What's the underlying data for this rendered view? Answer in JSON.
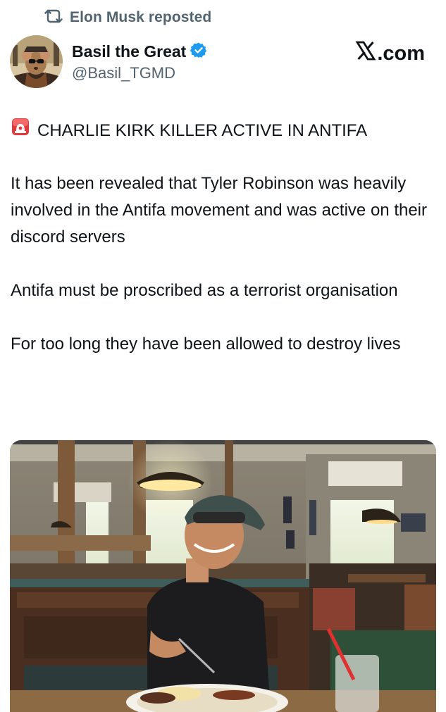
{
  "repost": {
    "icon": "repost-icon",
    "label": "Elon Musk reposted"
  },
  "author": {
    "name": "Basil the Great",
    "handle": "@Basil_TGMD",
    "verified_icon": "verified-badge-icon",
    "verified_color": "#1d9bf0"
  },
  "source_site": {
    "icon": "x-logo-icon",
    "label": ".com"
  },
  "post": {
    "headline_icon": "siren-icon",
    "headline": "CHARLIE KIRK KILLER ACTIVE IN ANTIFA",
    "paragraphs": [
      "It has been revealed that Tyler Robinson was heavily involved in the Antifa movement and was active on their discord servers",
      "Antifa must be proscribed as a terrorist organisation",
      "For too long they have been allowed to destroy lives"
    ]
  },
  "media": {
    "kind": "photo",
    "description_icon": "restaurant-photo"
  },
  "colors": {
    "secondary_text": "#536471",
    "primary_text": "#0f1419",
    "accent": "#1d9bf0"
  }
}
